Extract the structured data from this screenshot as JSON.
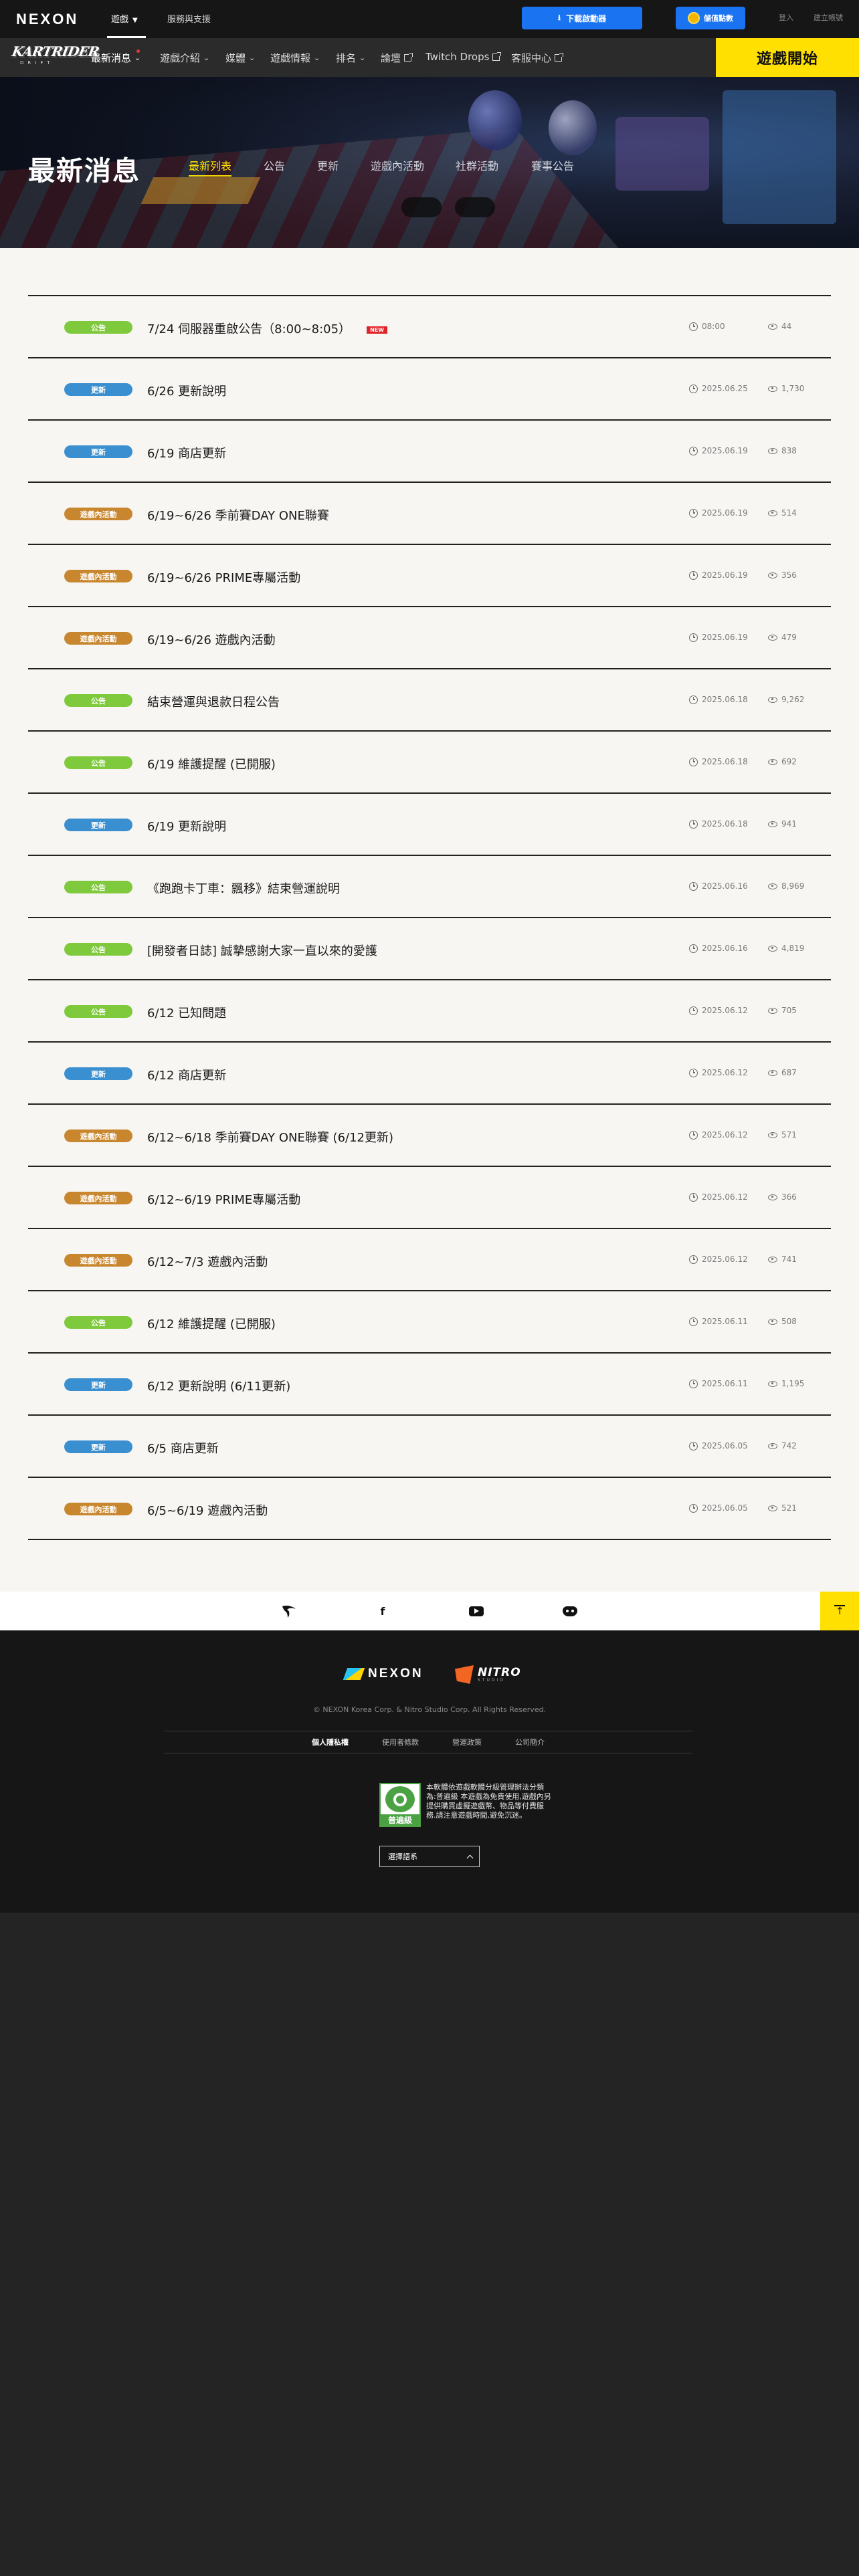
{
  "topbar": {
    "logo": "NEXON",
    "games_label": "遊戲",
    "support_label": "服務與支援",
    "download_label": "下載啟動器",
    "points_label": "儲值點數",
    "login_label": "登入",
    "signup_label": "建立帳號"
  },
  "gamenav": {
    "logo_main": "KARTRIDER",
    "logo_sub": "DRIFT",
    "items": [
      {
        "label": "最新消息"
      },
      {
        "label": "遊戲介紹"
      },
      {
        "label": "媒體"
      },
      {
        "label": "遊戲情報"
      },
      {
        "label": "排名"
      },
      {
        "label": "論壇"
      },
      {
        "label": "Twitch Drops"
      },
      {
        "label": "客服中心"
      }
    ],
    "play_label": "遊戲開始"
  },
  "hero": {
    "title": "最新消息",
    "tabs": [
      "最新列表",
      "公告",
      "更新",
      "遊戲內活動",
      "社群活動",
      "賽事公告"
    ]
  },
  "colors": {
    "notice": "#7fc93c",
    "update": "#3a8fd0",
    "event": "#c8862e",
    "accent": "#ffe000"
  },
  "news": [
    {
      "category": "公告",
      "type": "notice",
      "title": "7/24 伺服器重啟公告（8:00~8:05）",
      "new_badge": "NEW",
      "date": "08:00",
      "views": "44"
    },
    {
      "category": "更新",
      "type": "update",
      "title": "6/26 更新說明",
      "date": "2025.06.25",
      "views": "1,730"
    },
    {
      "category": "更新",
      "type": "update",
      "title": "6/19 商店更新",
      "date": "2025.06.19",
      "views": "838"
    },
    {
      "category": "遊戲內活動",
      "type": "event",
      "title": "6/19~6/26 季前賽DAY ONE聯賽",
      "date": "2025.06.19",
      "views": "514"
    },
    {
      "category": "遊戲內活動",
      "type": "event",
      "title": "6/19~6/26 PRIME專屬活動",
      "date": "2025.06.19",
      "views": "356"
    },
    {
      "category": "遊戲內活動",
      "type": "event",
      "title": "6/19~6/26 遊戲內活動",
      "date": "2025.06.19",
      "views": "479"
    },
    {
      "category": "公告",
      "type": "notice",
      "title": "結束營運與退款日程公告",
      "date": "2025.06.18",
      "views": "9,262"
    },
    {
      "category": "公告",
      "type": "notice",
      "title": "6/19 維護提醒 (已開服)",
      "date": "2025.06.18",
      "views": "692"
    },
    {
      "category": "更新",
      "type": "update",
      "title": "6/19 更新說明",
      "date": "2025.06.18",
      "views": "941"
    },
    {
      "category": "公告",
      "type": "notice",
      "title": "《跑跑卡丁車：飄移》結束營運說明",
      "date": "2025.06.16",
      "views": "8,969"
    },
    {
      "category": "公告",
      "type": "notice",
      "title": "[開發者日誌] 誠摯感謝大家一直以來的愛護",
      "date": "2025.06.16",
      "views": "4,819"
    },
    {
      "category": "公告",
      "type": "notice",
      "title": "6/12 已知問題",
      "date": "2025.06.12",
      "views": "705"
    },
    {
      "category": "更新",
      "type": "update",
      "title": "6/12 商店更新",
      "date": "2025.06.12",
      "views": "687"
    },
    {
      "category": "遊戲內活動",
      "type": "event",
      "title": "6/12~6/18 季前賽DAY ONE聯賽 (6/12更新)",
      "date": "2025.06.12",
      "views": "571"
    },
    {
      "category": "遊戲內活動",
      "type": "event",
      "title": "6/12~6/19 PRIME專屬活動",
      "date": "2025.06.12",
      "views": "366"
    },
    {
      "category": "遊戲內活動",
      "type": "event",
      "title": "6/12~7/3 遊戲內活動",
      "date": "2025.06.12",
      "views": "741"
    },
    {
      "category": "公告",
      "type": "notice",
      "title": "6/12 維護提醒 (已開服)",
      "date": "2025.06.11",
      "views": "508"
    },
    {
      "category": "更新",
      "type": "update",
      "title": "6/12 更新說明 (6/11更新)",
      "date": "2025.06.11",
      "views": "1,195"
    },
    {
      "category": "更新",
      "type": "update",
      "title": "6/5 商店更新",
      "date": "2025.06.05",
      "views": "742"
    },
    {
      "category": "遊戲內活動",
      "type": "event",
      "title": "6/5~6/19 遊戲內活動",
      "date": "2025.06.05",
      "views": "521"
    }
  ],
  "social": {
    "icons": [
      "bird-logo-icon",
      "facebook-icon",
      "youtube-icon",
      "discord-icon"
    ],
    "facebook_glyph": "f"
  },
  "footer": {
    "nexon_logo": "NEXON",
    "nitro_logo": "NITRO",
    "nitro_sub": "STUDIO",
    "copyright": "© NEXON Korea Corp. & Nitro Studio Corp. All Rights Reserved.",
    "links": [
      "個人隱私權",
      "使用者條款",
      "營運政策",
      "公司簡介"
    ],
    "rating_label": "普遍級",
    "rating_text": "本軟體依遊戲軟體分級管理辦法分類為:普遍級 本遊戲為免費使用,遊戲內另提供購買虛擬遊戲幣、物品等付費服務.請注意遊戲時間,避免沉迷。",
    "language_label": "選擇語系"
  }
}
